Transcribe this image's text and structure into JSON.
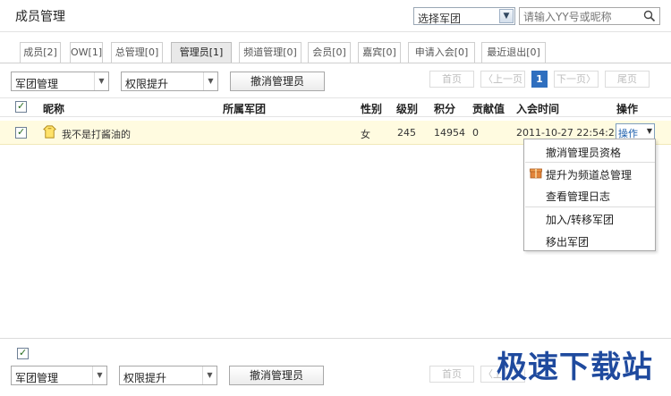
{
  "header": {
    "title": "成员管理",
    "group_select": "选择军团",
    "search_placeholder": "请输入YY号或昵称"
  },
  "tabs": [
    {
      "label": "成员[2]"
    },
    {
      "label": "OW[1]"
    },
    {
      "label": "总管理[0]"
    },
    {
      "label": "管理员[1]",
      "active": true
    },
    {
      "label": "频道管理[0]"
    },
    {
      "label": "会员[0]"
    },
    {
      "label": "嘉宾[0]"
    },
    {
      "label": "申请入会[0]"
    },
    {
      "label": "最近退出[0]"
    }
  ],
  "toolbar": {
    "group_manage": "军团管理",
    "promote": "权限提升",
    "revoke_admin": "撤消管理员"
  },
  "pagination": {
    "first": "首页",
    "prev": "〈上一页",
    "current": "1",
    "next": "下一页〉",
    "last": "尾页"
  },
  "columns": [
    "昵称",
    "所属军团",
    "性别",
    "级别",
    "积分",
    "贡献值",
    "入会时间",
    "操作"
  ],
  "rows": [
    {
      "nickname": "我不是打酱油的",
      "group": "",
      "gender": "女",
      "level": "245",
      "points": "14954",
      "contribution": "0",
      "join_time": "2011-10-27 22:54:23",
      "action": "操作"
    }
  ],
  "action_menu": [
    "撤消管理员资格",
    "提升为频道总管理",
    "查看管理日志",
    "加入/转移军团",
    "移出军团"
  ],
  "watermark": "极速下载站",
  "colors": {
    "highlight_row": "#fffbe0",
    "accent_blue": "#2f6fbf",
    "watermark": "#1f4a9e"
  }
}
